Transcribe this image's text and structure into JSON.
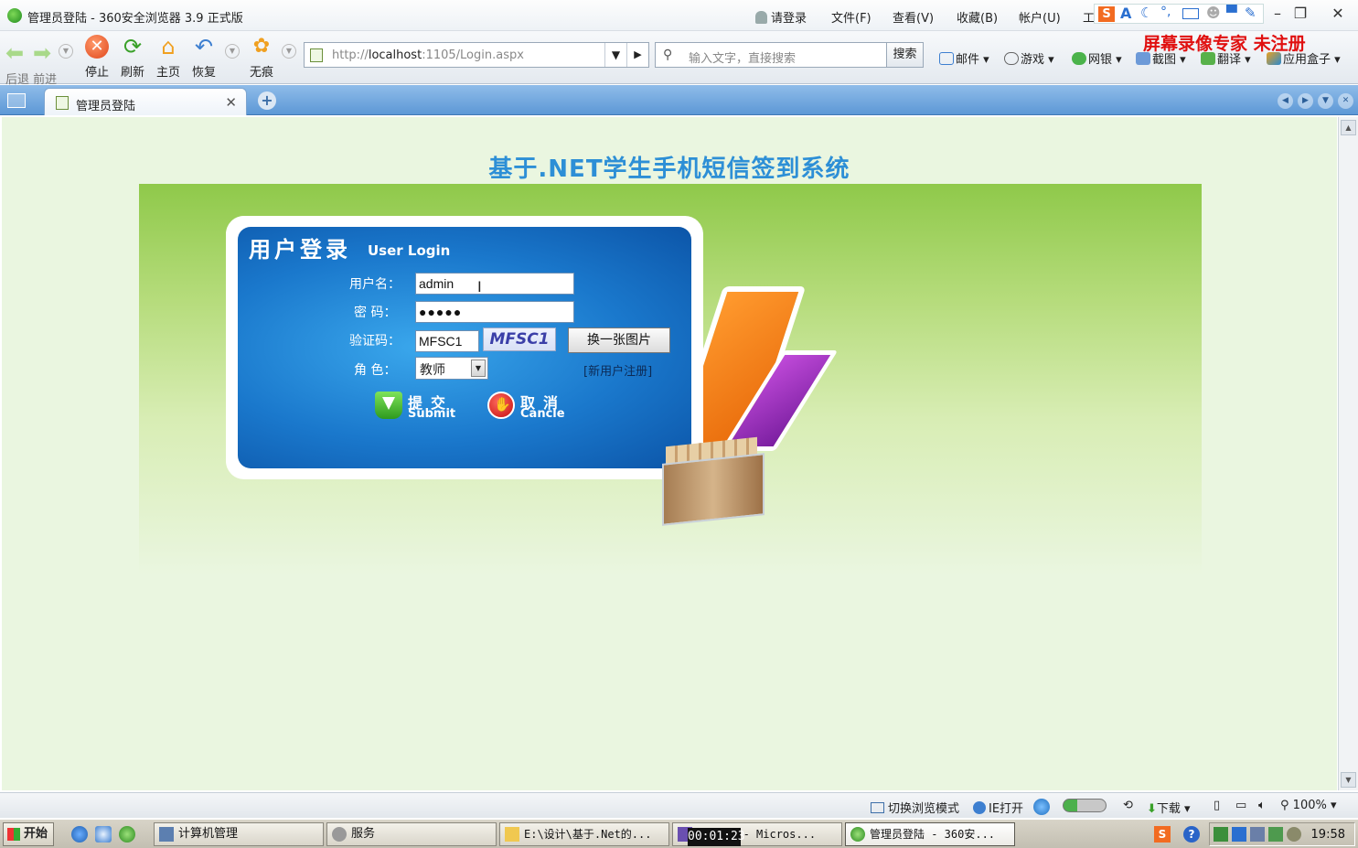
{
  "window": {
    "title": "管理员登陆 - 360安全浏览器 3.9 正式版",
    "login_prompt": "请登录",
    "menus": [
      "文件(F)",
      "查看(V)",
      "收藏(B)",
      "帐户(U)",
      "工"
    ]
  },
  "nav": {
    "back_forward": "后退 前进",
    "stop": "停止",
    "refresh": "刷新",
    "home": "主页",
    "restore": "恢复",
    "incognito": "无痕"
  },
  "address": {
    "prefix": "http://",
    "host": "localhost",
    "rest": ":1105/Login.aspx"
  },
  "search": {
    "placeholder": "输入文字，直接搜索",
    "button": "搜索"
  },
  "toolbar_items": [
    "邮件",
    "游戏",
    "网银",
    "截图",
    "翻译",
    "应用盒子"
  ],
  "watermark": "屏幕录像专家 未注册",
  "tab": {
    "label": "管理员登陆"
  },
  "page": {
    "title": "基于.NET学生手机短信签到系统",
    "login_title_cn": "用户登录",
    "login_title_en": "User Login",
    "labels": {
      "username": "用户名：",
      "password": "密 码：",
      "captcha": "验证码：",
      "role": "角 色："
    },
    "values": {
      "username": "admin",
      "password": "●●●●●",
      "captcha_input": "MFSC1",
      "captcha_image": "MFSC1",
      "role": "教师"
    },
    "change_image": "换一张图片",
    "register": "[新用户注册]",
    "submit_cn": "提交",
    "submit_en": "Submit",
    "cancel_cn": "取消",
    "cancel_en": "Cancle"
  },
  "statusbar": {
    "switch_mode": "切换浏览模式",
    "ie_open": "IE打开",
    "download": "下载",
    "zoom": "100%"
  },
  "taskbar": {
    "start": "开始",
    "tasks": [
      "计算机管理",
      "服务",
      "E:\\设计\\基于.Net的...",
      "oInOIn - Micros...",
      "管理员登陆 - 360安..."
    ],
    "clock": "19:58",
    "recording_time": "00:01:23"
  }
}
